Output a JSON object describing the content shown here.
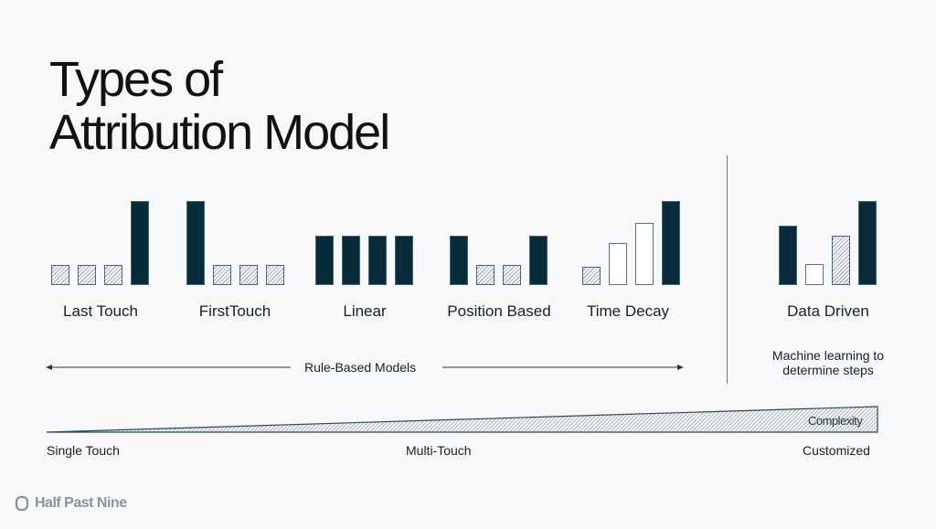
{
  "title_line1": "Types of",
  "title_line2": "Attribution Model",
  "colors": {
    "dark": "#082b3a",
    "background": "#f7f8fa",
    "outline": "#4d6470"
  },
  "models": [
    {
      "name": "Last Touch",
      "bars": [
        {
          "style": "hatched",
          "value": 24
        },
        {
          "style": "hatched",
          "value": 24
        },
        {
          "style": "hatched",
          "value": 24
        },
        {
          "style": "filled",
          "value": 100
        }
      ]
    },
    {
      "name": "FirstTouch",
      "bars": [
        {
          "style": "filled",
          "value": 100
        },
        {
          "style": "hatched",
          "value": 24
        },
        {
          "style": "hatched",
          "value": 24
        },
        {
          "style": "hatched",
          "value": 24
        }
      ]
    },
    {
      "name": "Linear",
      "bars": [
        {
          "style": "filled",
          "value": 59
        },
        {
          "style": "filled",
          "value": 59
        },
        {
          "style": "filled",
          "value": 59
        },
        {
          "style": "filled",
          "value": 59
        }
      ]
    },
    {
      "name": "Position Based",
      "bars": [
        {
          "style": "filled",
          "value": 59
        },
        {
          "style": "hatched",
          "value": 24
        },
        {
          "style": "hatched",
          "value": 24
        },
        {
          "style": "filled",
          "value": 59
        }
      ]
    },
    {
      "name": "Time Decay",
      "bars": [
        {
          "style": "hatched",
          "value": 22
        },
        {
          "style": "outline",
          "value": 50
        },
        {
          "style": "outline",
          "value": 74
        },
        {
          "style": "filled",
          "value": 100
        }
      ]
    },
    {
      "name": "Data Driven",
      "bars": [
        {
          "style": "filled",
          "value": 71
        },
        {
          "style": "outline",
          "value": 25
        },
        {
          "style": "hatched",
          "value": 59
        },
        {
          "style": "filled",
          "value": 100
        }
      ]
    }
  ],
  "rule_based_label": "Rule-Based Models",
  "ml_label_line1": "Machine learning to",
  "ml_label_line2": "determine steps",
  "complexity_label": "Complexity",
  "scale": {
    "left": "Single Touch",
    "middle": "Multi-Touch",
    "right": "Customized"
  },
  "brand": "Half Past Nine",
  "brand_icon": "rounded-hexagon-outline-icon"
}
